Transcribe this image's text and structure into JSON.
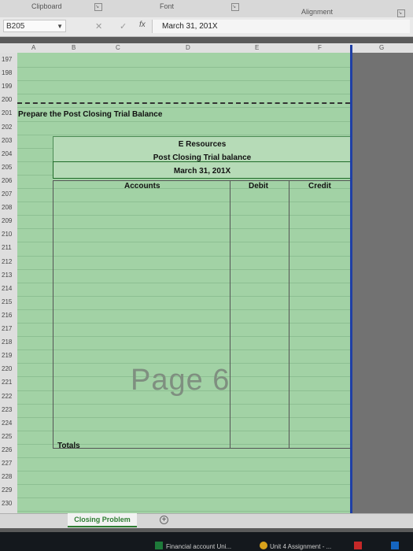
{
  "ribbon": {
    "clipboard": "Clipboard",
    "font": "Font",
    "alignment": "Alignment"
  },
  "formula_bar": {
    "name_box": "B205",
    "fx": "fx",
    "value": "March 31, 201X"
  },
  "columns": [
    "A",
    "B",
    "C",
    "D",
    "E",
    "F",
    "G"
  ],
  "rows": [
    "197",
    "198",
    "199",
    "200",
    "201",
    "202",
    "203",
    "204",
    "205",
    "206",
    "207",
    "208",
    "209",
    "210",
    "211",
    "212",
    "213",
    "214",
    "215",
    "216",
    "217",
    "218",
    "219",
    "220",
    "221",
    "222",
    "223",
    "224",
    "225",
    "226",
    "227",
    "228",
    "229",
    "230"
  ],
  "sheet": {
    "instruction": "Prepare the Post Closing Trial Balance",
    "company": "E Resources",
    "report_title": "Post Closing Trial balance",
    "report_date": "March 31, 201X",
    "col_accounts": "Accounts",
    "col_debit": "Debit",
    "col_credit": "Credit",
    "totals_label": "Totals",
    "watermark": "Page 6"
  },
  "tabs": {
    "active": "Closing Problem"
  },
  "taskbar": {
    "item1": "Financial account Uni...",
    "item2": "Unit 4 Assignment - ..."
  },
  "colors": {
    "grid_green": "#a2d2a5",
    "selection_blue": "#1f3fa6",
    "tab_green": "#2e7d32"
  }
}
